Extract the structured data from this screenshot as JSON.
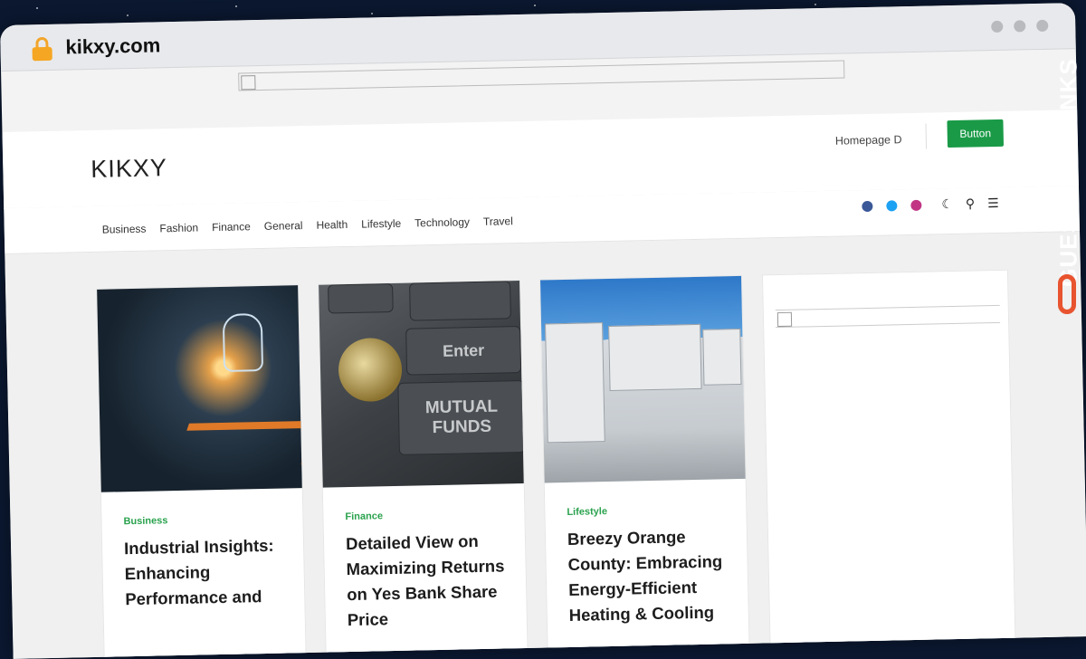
{
  "browser": {
    "url": "kikxy.com"
  },
  "header": {
    "logo": "KIKXY",
    "homepage_link": "Homepage D",
    "button_label": "Button"
  },
  "nav": {
    "links": [
      "Business",
      "Fashion",
      "Finance",
      "General",
      "Health",
      "Lifestyle",
      "Technology",
      "Travel"
    ],
    "social": [
      {
        "name": "facebook-icon",
        "color": "#3b5998"
      },
      {
        "name": "twitter-icon",
        "color": "#1da1f2"
      },
      {
        "name": "instagram-icon",
        "color": "#c13584"
      }
    ]
  },
  "cards": [
    {
      "category": "Business",
      "title": "Industrial Insights: Enhancing Performance and"
    },
    {
      "category": "Finance",
      "title": "Detailed View on Maximizing Returns on Yes Bank Share Price"
    },
    {
      "category": "Lifestyle",
      "title": "Breezy Orange County: Embracing Energy-Efficient Heating & Cooling"
    }
  ],
  "card_image_text": {
    "enter_key": "Enter",
    "mutual_funds": "MUTUAL FUNDS"
  },
  "watermark": {
    "text": "GUESTPOSTLINKS",
    "accent": "#e8542f"
  },
  "colors": {
    "accent_green": "#1a9a47",
    "category_green": "#2aa24d"
  }
}
